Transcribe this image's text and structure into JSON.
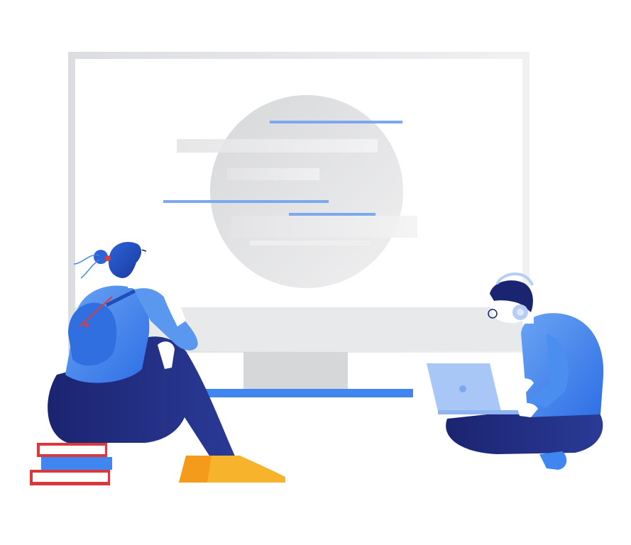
{
  "illustration": {
    "palette": {
      "background": "#ffffff",
      "monitor_frame": "#e6e7e9",
      "monitor_screen": "#ffffff",
      "monitor_stand": "#d9dadc",
      "monitor_base": "#3f86f1",
      "screen_circle": "#e2e3e5",
      "text_line_gray": "#e9e9ea",
      "text_line_blue": "#7ea8ee",
      "skin": "#ffffff",
      "hair": "#1f3fa8",
      "shirt_blue": "#4a8ff0",
      "pants_navy": "#1b2470",
      "shoes_yellow": "#f7b32b",
      "backpack": "#2f6fe0",
      "accent_red": "#e03a3e",
      "book_red": "#d9383d",
      "book_blue": "#3f86f1",
      "laptop": "#a9c7f6",
      "headphones": "#b7cdf3"
    },
    "figures": [
      {
        "name": "thinking-woman",
        "icon": "person-sitting-on-books"
      },
      {
        "name": "man-with-laptop",
        "icon": "person-cross-legged-laptop"
      }
    ]
  }
}
